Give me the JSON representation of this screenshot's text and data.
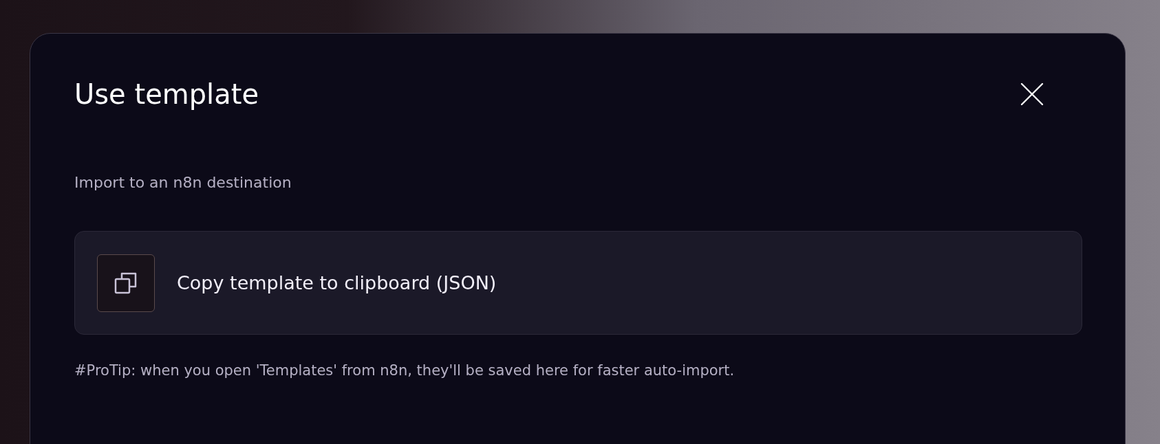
{
  "dialog": {
    "title": "Use template",
    "subtitle": "Import to an n8n destination",
    "options": [
      {
        "kind": "copy",
        "label": "Copy template to clipboard (JSON)"
      }
    ],
    "tip": "#ProTip: when you open 'Templates' from n8n, they'll be saved here for faster auto-import."
  }
}
